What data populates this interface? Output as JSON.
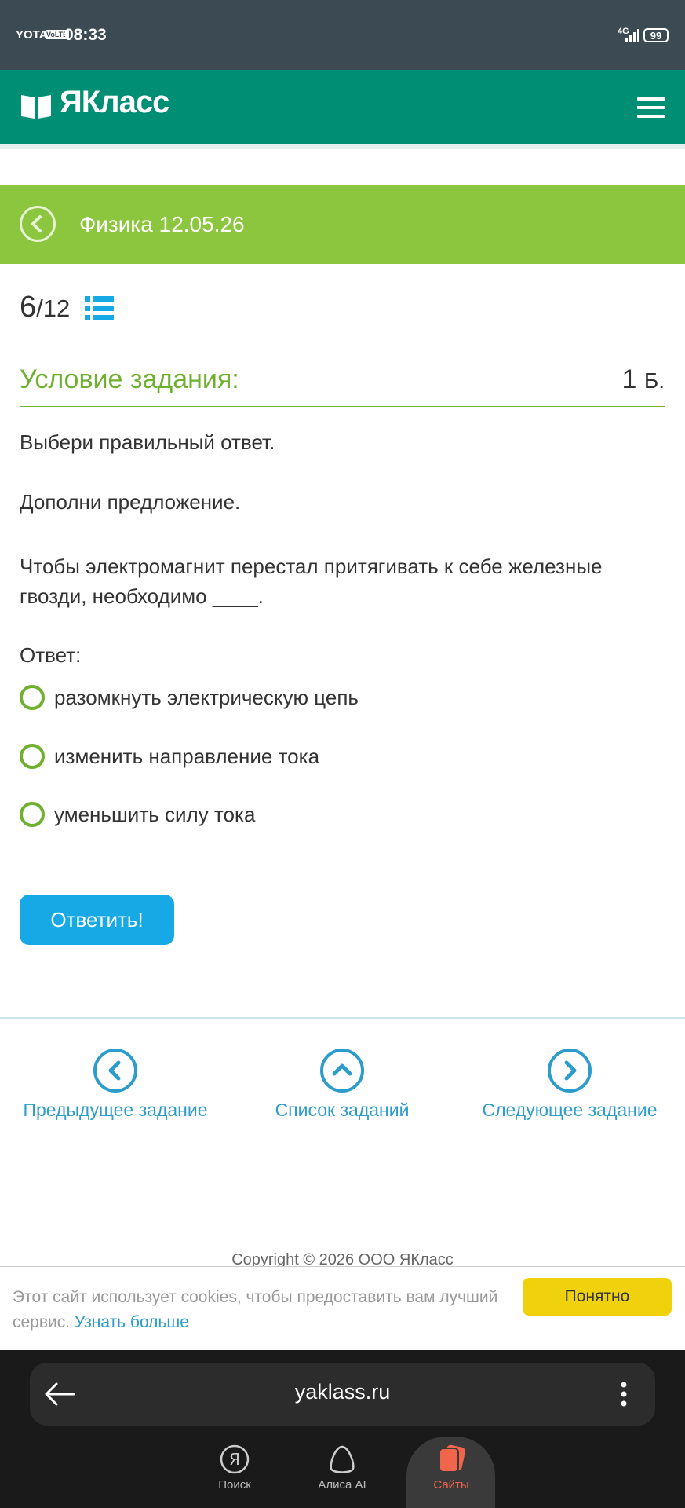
{
  "status_bar": {
    "carrier": "YOTA",
    "volte": "VoLTE",
    "time": "08:33",
    "network": "4G",
    "battery": "99"
  },
  "header": {
    "logo_text": "ЯКласс",
    "brand_color": "#008e74"
  },
  "lesson": {
    "title": "Физика 12.05.26",
    "bar_color": "#8cc63f"
  },
  "progress": {
    "current": "6",
    "total": "/12"
  },
  "task": {
    "heading": "Условие задания:",
    "points": "1",
    "points_unit": "Б.",
    "instruction": "Выбери правильный ответ.",
    "supplement": "Дополни предложение.",
    "question": "Чтобы электромагнит перестал притягивать к себе железные гвозди, необходимо ____.",
    "answer_label": "Ответ:",
    "options": [
      "разомкнуть электрическую цепь",
      "изменить направление тока",
      "уменьшить силу тока"
    ],
    "submit_label": "Ответить!"
  },
  "navigation": {
    "prev": "Предыдущее задание",
    "list": "Список заданий",
    "next": "Следующее задание"
  },
  "footer": {
    "copyright": "Copyright © 2026 ООО ЯКласс"
  },
  "cookie": {
    "text": "Этот сайт использует cookies, чтобы предоставить вам лучший сервис.",
    "link": "Узнать больше",
    "accept": "Понятно"
  },
  "browser": {
    "url": "yaklass.ru",
    "tabs": [
      "Поиск",
      "Алиса AI",
      "Сайты"
    ]
  },
  "colors": {
    "accent_blue": "#17a9e6",
    "link_blue": "#2c9ccc",
    "cookie_button": "#f0d20c"
  }
}
